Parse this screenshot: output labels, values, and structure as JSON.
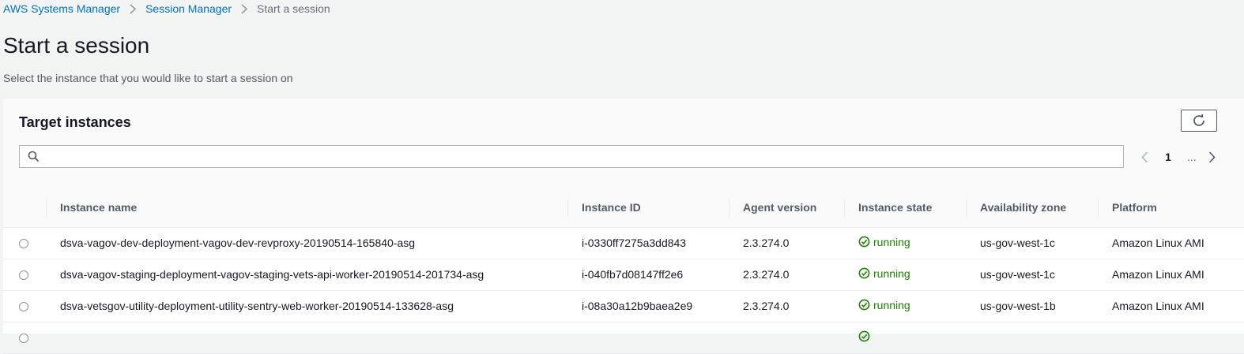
{
  "breadcrumb": {
    "items": [
      "AWS Systems Manager",
      "Session Manager"
    ],
    "current": "Start a session"
  },
  "page": {
    "title": "Start a session",
    "description": "Select the instance that you would like to start a session on"
  },
  "panel": {
    "title": "Target instances",
    "search_placeholder": "",
    "pagination": {
      "current_page": "1",
      "ellipsis": "..."
    }
  },
  "table": {
    "columns": [
      "Instance name",
      "Instance ID",
      "Agent version",
      "Instance state",
      "Availability zone",
      "Platform"
    ],
    "rows": [
      {
        "name": "dsva-vagov-dev-deployment-vagov-dev-revproxy-20190514-165840-asg",
        "id": "i-0330ff7275a3dd843",
        "agent": "2.3.274.0",
        "state": "running",
        "az": "us-gov-west-1c",
        "platform": "Amazon Linux AMI"
      },
      {
        "name": "dsva-vagov-staging-deployment-vagov-staging-vets-api-worker-20190514-201734-asg",
        "id": "i-040fb7d08147ff2e6",
        "agent": "2.3.274.0",
        "state": "running",
        "az": "us-gov-west-1c",
        "platform": "Amazon Linux AMI"
      },
      {
        "name": "dsva-vetsgov-utility-deployment-utility-sentry-web-worker-20190514-133628-asg",
        "id": "i-08a30a12b9baea2e9",
        "agent": "2.3.274.0",
        "state": "running",
        "az": "us-gov-west-1b",
        "platform": "Amazon Linux AMI"
      }
    ]
  },
  "colors": {
    "link": "#0073bb",
    "success": "#1d8102",
    "background": "#f2f3f3"
  }
}
